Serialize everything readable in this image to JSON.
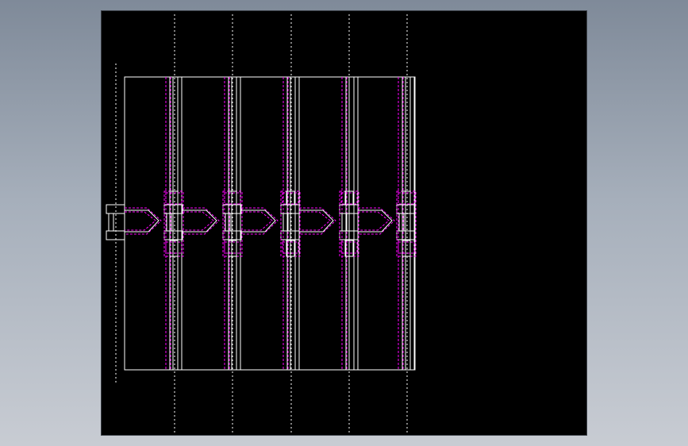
{
  "viewport": {
    "name": "cad-drawing-viewport",
    "background_color": "#000000",
    "frame_color": "#9aa3af"
  },
  "drawing": {
    "line_colors": {
      "outline": "#ffffff",
      "hidden": "#ff00ff",
      "centerline": "#ffffff"
    },
    "panel_count": 5,
    "link_count": 6
  }
}
